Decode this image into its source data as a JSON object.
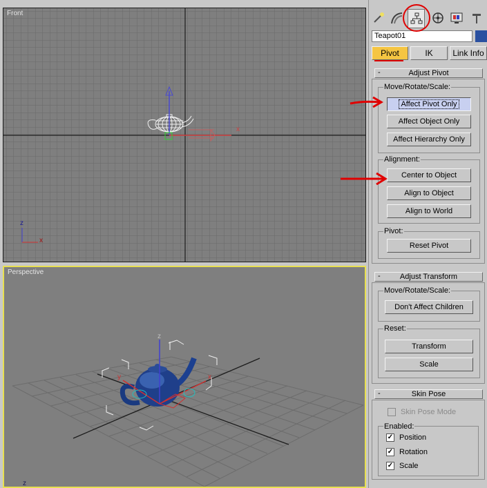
{
  "viewports": {
    "top_label": "Front",
    "bottom_label": "Perspective",
    "front_axis_x": "x",
    "front_axis_z": "z",
    "front_gizmo_x": "x",
    "persp_gizmo_x": "x",
    "persp_gizmo_y": "y",
    "persp_gizmo_z": "z",
    "persp_corner_z": "z"
  },
  "command_panel": {
    "tabs": [
      "create-icon",
      "modify-icon",
      "hierarchy-icon",
      "motion-icon",
      "display-icon",
      "utilities-icon"
    ],
    "active_tab": "hierarchy",
    "object_name": "Teapot01",
    "object_color": "#2a50a0",
    "subtabs": {
      "pivot": "Pivot",
      "ik": "IK",
      "link_info": "Link Info"
    }
  },
  "adjust_pivot": {
    "minus": "-",
    "title": "Adjust Pivot",
    "move_group": "Move/Rotate/Scale:",
    "affect_pivot_only": "Affect Pivot Only",
    "affect_object_only": "Affect Object Only",
    "affect_hierarchy_only": "Affect Hierarchy Only",
    "alignment_group": "Alignment:",
    "center_to_object": "Center to Object",
    "align_to_object": "Align to Object",
    "align_to_world": "Align to World",
    "pivot_group": "Pivot:",
    "reset_pivot": "Reset Pivot"
  },
  "adjust_transform": {
    "minus": "-",
    "title": "Adjust Transform",
    "move_group": "Move/Rotate/Scale:",
    "dont_affect_children": "Don't Affect Children",
    "reset_group": "Reset:",
    "transform": "Transform",
    "scale": "Scale"
  },
  "skin_pose": {
    "minus": "-",
    "title": "Skin Pose",
    "skin_pose_mode": "Skin Pose Mode",
    "enabled_group": "Enabled:",
    "position": "Position",
    "rotation": "Rotation",
    "scale": "Scale",
    "check": "✓"
  },
  "colors": {
    "annotation": "#e00000",
    "active_viewport_border": "#e8e050",
    "gizmo_blue": "#4040d0",
    "gizmo_red": "#d03030"
  }
}
